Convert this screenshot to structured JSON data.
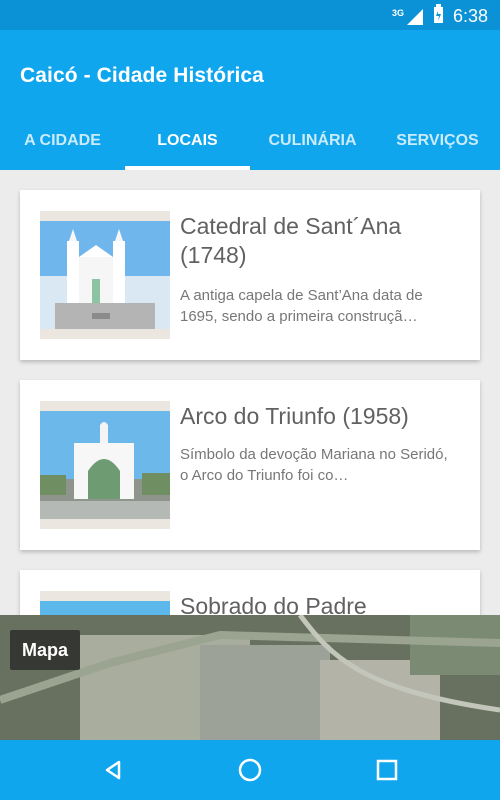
{
  "status_bar": {
    "network": "3G",
    "time": "6:38"
  },
  "app_bar": {
    "title": "Caicó - Cidade Histórica"
  },
  "tabs": [
    {
      "label": "A CIDADE"
    },
    {
      "label": "LOCAIS"
    },
    {
      "label": "CULINÁRIA"
    },
    {
      "label": "SERVIÇOS"
    }
  ],
  "places": [
    {
      "title": "Catedral de Sant´Ana (1748)",
      "description": "A antiga capela de Sant’Ana data de 1695, sendo a primeira construçã…"
    },
    {
      "title": "Arco do Triunfo (1958)",
      "description": "Símbolo da devoção Mariana no Seridó, o Arco do Triunfo foi co…"
    },
    {
      "title": "Sobrado do Padre",
      "description": ""
    }
  ],
  "map": {
    "label": "Mapa"
  },
  "nav_icons": [
    "back-icon",
    "home-icon",
    "recents-icon"
  ]
}
